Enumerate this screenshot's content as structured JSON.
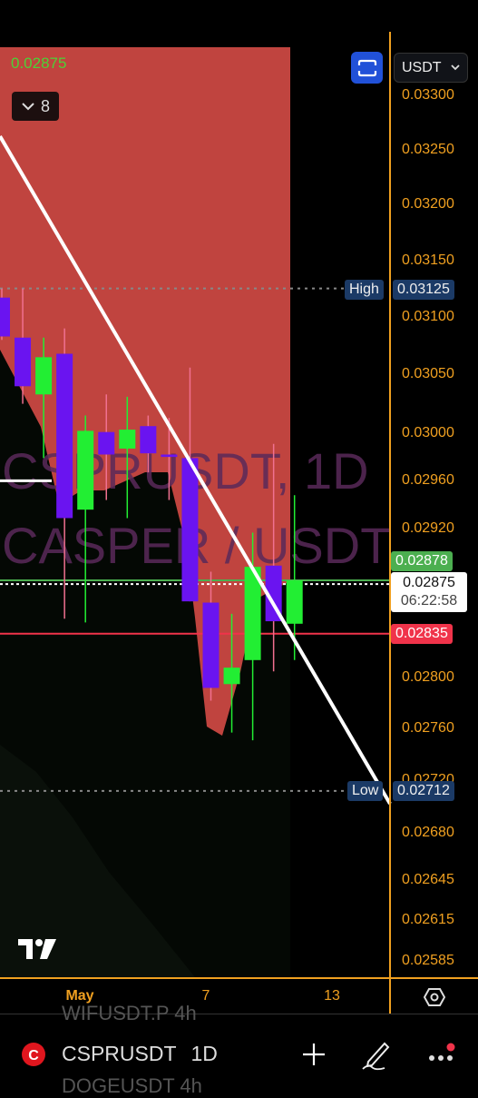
{
  "header": {
    "last_price": "0.02875",
    "indicators_collapse_count": "8",
    "currency": "USDT"
  },
  "watermark": {
    "line1": "CSPRUSDT, 1D",
    "line2": "CASPER / USDT"
  },
  "price_axis": {
    "scale": "log",
    "range": [
      0.0257,
      0.0333
    ],
    "ticks": [
      "0.03300",
      "0.03250",
      "0.03200",
      "0.03150",
      "0.03100",
      "0.03050",
      "0.03000",
      "0.02960",
      "0.02920",
      "0.02800",
      "0.02760",
      "0.02720",
      "0.02680",
      "0.02645",
      "0.02615",
      "0.02585"
    ]
  },
  "markers": {
    "high": {
      "label": "High",
      "value": "0.03125"
    },
    "low": {
      "label": "Low",
      "value": "0.02712"
    },
    "green_line": "0.02878",
    "current": {
      "value": "0.02875",
      "countdown": "06:22:58"
    },
    "red_line": "0.02835",
    "white_segment": "0.02960"
  },
  "time_axis": {
    "labels": [
      "May",
      "7",
      "13"
    ]
  },
  "colors": {
    "up": "#22ee33",
    "down": "#6a14f0",
    "zone": "#c0443f",
    "axis": "#f0a020",
    "accent": "#2151d8",
    "low_tag": "#1b3a66",
    "red_tag": "#f0334a",
    "green_tag": "#4caf50"
  },
  "chart_data": {
    "type": "candlestick",
    "candles": [
      {
        "o": 0.03117,
        "h": 0.03125,
        "l": 0.0308,
        "c": 0.03083
      },
      {
        "o": 0.03082,
        "h": 0.03125,
        "l": 0.03025,
        "c": 0.0304
      },
      {
        "o": 0.03033,
        "h": 0.03082,
        "l": 0.02979,
        "c": 0.03065
      },
      {
        "o": 0.03068,
        "h": 0.0309,
        "l": 0.02847,
        "c": 0.02929
      },
      {
        "o": 0.02936,
        "h": 0.03015,
        "l": 0.02844,
        "c": 0.03002
      },
      {
        "o": 0.03001,
        "h": 0.03033,
        "l": 0.02944,
        "c": 0.02982
      },
      {
        "o": 0.02987,
        "h": 0.03031,
        "l": 0.02929,
        "c": 0.03003
      },
      {
        "o": 0.03006,
        "h": 0.03015,
        "l": 0.02967,
        "c": 0.02983
      },
      {
        "o": 0.02982,
        "h": 0.03013,
        "l": 0.02944,
        "c": 0.0298
      },
      {
        "o": 0.02979,
        "h": 0.03056,
        "l": 0.02861,
        "c": 0.02861
      },
      {
        "o": 0.0286,
        "h": 0.02885,
        "l": 0.02782,
        "c": 0.02792
      },
      {
        "o": 0.02795,
        "h": 0.02851,
        "l": 0.02757,
        "c": 0.02808
      },
      {
        "o": 0.02814,
        "h": 0.02917,
        "l": 0.02751,
        "c": 0.02889
      },
      {
        "o": 0.0289,
        "h": 0.02991,
        "l": 0.02805,
        "c": 0.02845
      },
      {
        "o": 0.02843,
        "h": 0.02948,
        "l": 0.02814,
        "c": 0.02878
      }
    ]
  },
  "footer": {
    "symbol": "CSPRUSDT",
    "interval": "1D",
    "prev_symbol": "WIFUSDT.P 4h",
    "next_symbol": "DOGEUSDT 4h"
  }
}
